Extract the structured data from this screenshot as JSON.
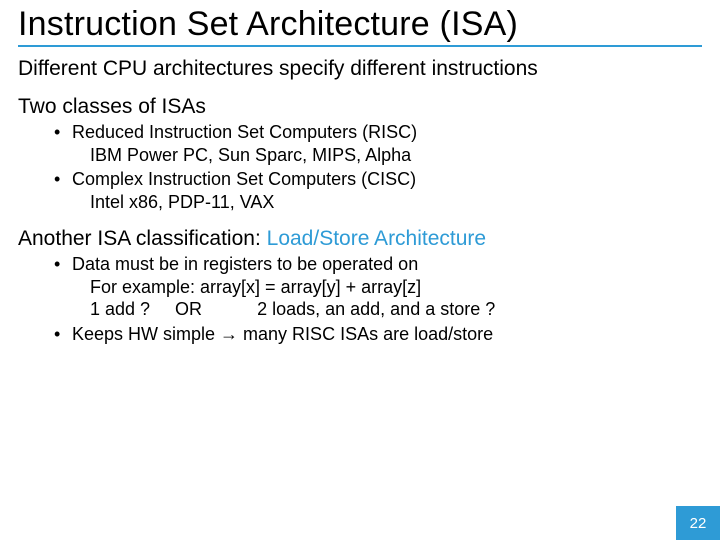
{
  "title": "Instruction Set Architecture (ISA)",
  "subtitle": "Different CPU architectures specify different instructions",
  "section1": {
    "text": "Two classes of ISAs"
  },
  "bullets1": {
    "b0": {
      "line1": "Reduced Instruction Set Computers (RISC)",
      "line2": "IBM Power PC, Sun Sparc, MIPS, Alpha"
    },
    "b1": {
      "line1": "Complex Instruction Set Computers (CISC)",
      "line2": "Intel x86, PDP-11, VAX"
    }
  },
  "section2": {
    "prefix": "Another ISA classification: ",
    "accent": "Load/Store Architecture"
  },
  "bullets2": {
    "b0": {
      "line1": "Data must be in registers to be operated on",
      "line2": "For example: array[x] = array[y] + array[z]",
      "line3": "1 add ?     OR           2 loads, an add, and a store ?"
    },
    "b1": {
      "line1": "Keeps HW simple → many RISC ISAs are load/store"
    }
  },
  "page_number": "22"
}
